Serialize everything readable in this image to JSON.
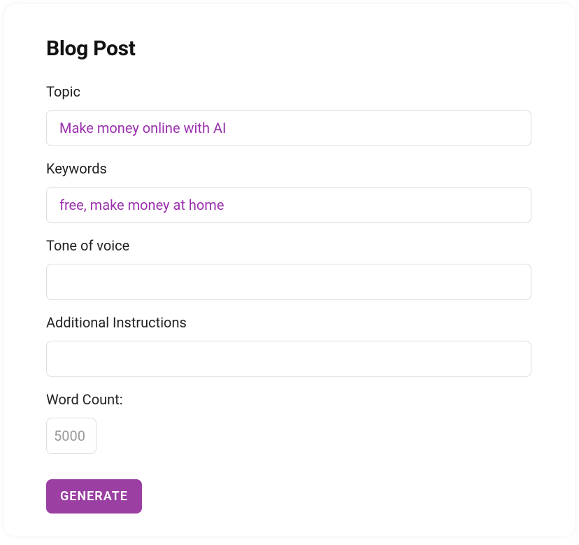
{
  "title": "Blog Post",
  "fields": {
    "topic": {
      "label": "Topic",
      "value": "Make money online with AI"
    },
    "keywords": {
      "label": "Keywords",
      "value": "free, make money at home"
    },
    "tone": {
      "label": "Tone of voice",
      "value": ""
    },
    "instructions": {
      "label": "Additional Instructions",
      "value": ""
    },
    "wordcount": {
      "label": "Word Count:",
      "placeholder": "5000",
      "value": ""
    }
  },
  "button": {
    "generate": "GENERATE"
  }
}
